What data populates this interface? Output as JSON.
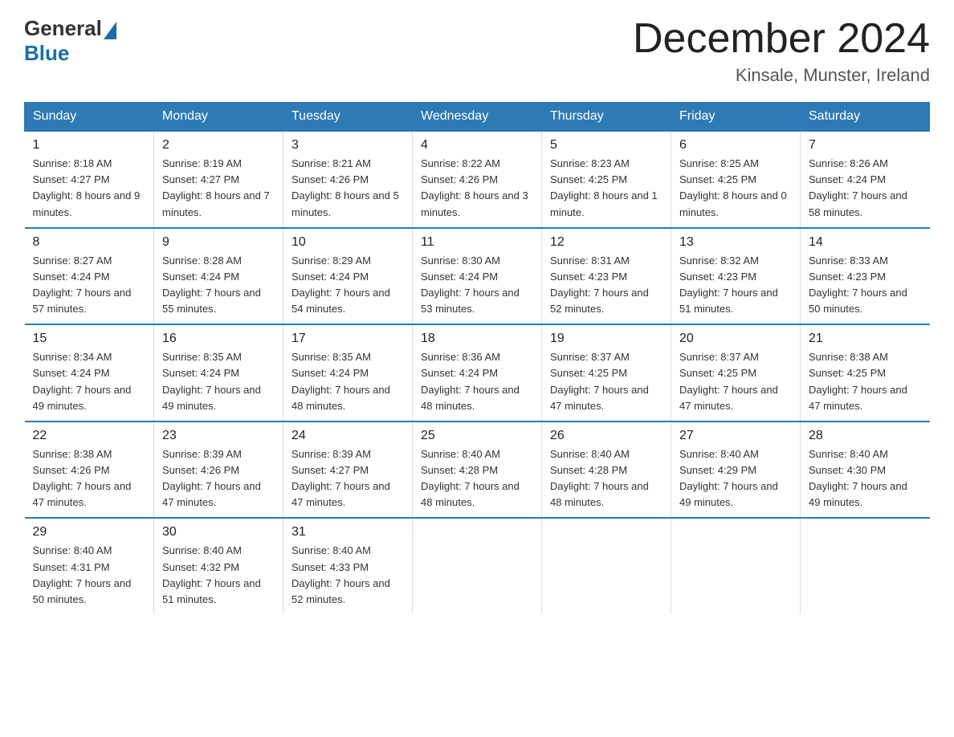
{
  "header": {
    "logo_general": "General",
    "logo_blue": "Blue",
    "month_title": "December 2024",
    "location": "Kinsale, Munster, Ireland"
  },
  "days_of_week": [
    "Sunday",
    "Monday",
    "Tuesday",
    "Wednesday",
    "Thursday",
    "Friday",
    "Saturday"
  ],
  "weeks": [
    [
      {
        "day": "1",
        "sunrise": "8:18 AM",
        "sunset": "4:27 PM",
        "daylight": "8 hours and 9 minutes."
      },
      {
        "day": "2",
        "sunrise": "8:19 AM",
        "sunset": "4:27 PM",
        "daylight": "8 hours and 7 minutes."
      },
      {
        "day": "3",
        "sunrise": "8:21 AM",
        "sunset": "4:26 PM",
        "daylight": "8 hours and 5 minutes."
      },
      {
        "day": "4",
        "sunrise": "8:22 AM",
        "sunset": "4:26 PM",
        "daylight": "8 hours and 3 minutes."
      },
      {
        "day": "5",
        "sunrise": "8:23 AM",
        "sunset": "4:25 PM",
        "daylight": "8 hours and 1 minute."
      },
      {
        "day": "6",
        "sunrise": "8:25 AM",
        "sunset": "4:25 PM",
        "daylight": "8 hours and 0 minutes."
      },
      {
        "day": "7",
        "sunrise": "8:26 AM",
        "sunset": "4:24 PM",
        "daylight": "7 hours and 58 minutes."
      }
    ],
    [
      {
        "day": "8",
        "sunrise": "8:27 AM",
        "sunset": "4:24 PM",
        "daylight": "7 hours and 57 minutes."
      },
      {
        "day": "9",
        "sunrise": "8:28 AM",
        "sunset": "4:24 PM",
        "daylight": "7 hours and 55 minutes."
      },
      {
        "day": "10",
        "sunrise": "8:29 AM",
        "sunset": "4:24 PM",
        "daylight": "7 hours and 54 minutes."
      },
      {
        "day": "11",
        "sunrise": "8:30 AM",
        "sunset": "4:24 PM",
        "daylight": "7 hours and 53 minutes."
      },
      {
        "day": "12",
        "sunrise": "8:31 AM",
        "sunset": "4:23 PM",
        "daylight": "7 hours and 52 minutes."
      },
      {
        "day": "13",
        "sunrise": "8:32 AM",
        "sunset": "4:23 PM",
        "daylight": "7 hours and 51 minutes."
      },
      {
        "day": "14",
        "sunrise": "8:33 AM",
        "sunset": "4:23 PM",
        "daylight": "7 hours and 50 minutes."
      }
    ],
    [
      {
        "day": "15",
        "sunrise": "8:34 AM",
        "sunset": "4:24 PM",
        "daylight": "7 hours and 49 minutes."
      },
      {
        "day": "16",
        "sunrise": "8:35 AM",
        "sunset": "4:24 PM",
        "daylight": "7 hours and 49 minutes."
      },
      {
        "day": "17",
        "sunrise": "8:35 AM",
        "sunset": "4:24 PM",
        "daylight": "7 hours and 48 minutes."
      },
      {
        "day": "18",
        "sunrise": "8:36 AM",
        "sunset": "4:24 PM",
        "daylight": "7 hours and 48 minutes."
      },
      {
        "day": "19",
        "sunrise": "8:37 AM",
        "sunset": "4:25 PM",
        "daylight": "7 hours and 47 minutes."
      },
      {
        "day": "20",
        "sunrise": "8:37 AM",
        "sunset": "4:25 PM",
        "daylight": "7 hours and 47 minutes."
      },
      {
        "day": "21",
        "sunrise": "8:38 AM",
        "sunset": "4:25 PM",
        "daylight": "7 hours and 47 minutes."
      }
    ],
    [
      {
        "day": "22",
        "sunrise": "8:38 AM",
        "sunset": "4:26 PM",
        "daylight": "7 hours and 47 minutes."
      },
      {
        "day": "23",
        "sunrise": "8:39 AM",
        "sunset": "4:26 PM",
        "daylight": "7 hours and 47 minutes."
      },
      {
        "day": "24",
        "sunrise": "8:39 AM",
        "sunset": "4:27 PM",
        "daylight": "7 hours and 47 minutes."
      },
      {
        "day": "25",
        "sunrise": "8:40 AM",
        "sunset": "4:28 PM",
        "daylight": "7 hours and 48 minutes."
      },
      {
        "day": "26",
        "sunrise": "8:40 AM",
        "sunset": "4:28 PM",
        "daylight": "7 hours and 48 minutes."
      },
      {
        "day": "27",
        "sunrise": "8:40 AM",
        "sunset": "4:29 PM",
        "daylight": "7 hours and 49 minutes."
      },
      {
        "day": "28",
        "sunrise": "8:40 AM",
        "sunset": "4:30 PM",
        "daylight": "7 hours and 49 minutes."
      }
    ],
    [
      {
        "day": "29",
        "sunrise": "8:40 AM",
        "sunset": "4:31 PM",
        "daylight": "7 hours and 50 minutes."
      },
      {
        "day": "30",
        "sunrise": "8:40 AM",
        "sunset": "4:32 PM",
        "daylight": "7 hours and 51 minutes."
      },
      {
        "day": "31",
        "sunrise": "8:40 AM",
        "sunset": "4:33 PM",
        "daylight": "7 hours and 52 minutes."
      },
      null,
      null,
      null,
      null
    ]
  ]
}
